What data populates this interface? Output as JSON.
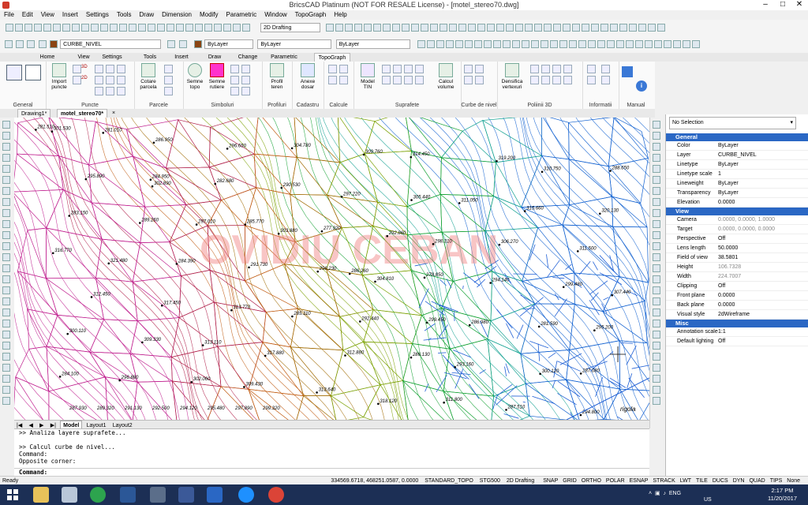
{
  "window": {
    "title": "BricsCAD Platinum (NOT FOR RESALE License) - [motel_stereo70.dwg]",
    "minimize": "–",
    "maximize": "□",
    "close": "✕"
  },
  "menu": [
    "File",
    "Edit",
    "View",
    "Insert",
    "Settings",
    "Tools",
    "Draw",
    "Dimension",
    "Modify",
    "Parametric",
    "Window",
    "TopoGraph",
    "Help"
  ],
  "toolbar": {
    "workspace": "2D Drafting",
    "layer": "CURBE_NIVEL",
    "color": "ByLayer",
    "linetype": "ByLayer",
    "lineweight": "ByLayer"
  },
  "ribbon_tabs": [
    "Home",
    "View",
    "Settings",
    "Tools",
    "Insert",
    "Draw",
    "Change",
    "Parametric",
    "TopoGraph"
  ],
  "ribbon_active_tab": "TopoGraph",
  "ribbon": {
    "groups": [
      "General",
      "Puncte",
      "Parcele",
      "Simboluri",
      "Profiluri",
      "Cadastru",
      "Calcule",
      "Suprafete",
      "Curbe de nivel",
      "Poliinii 3D",
      "Informatii",
      "Manual"
    ],
    "buttons": {
      "import": "Import puncte",
      "cotare": "Cotare parcela",
      "semne_topo": "Semne topo",
      "semne_rutiere": "Semne rutiere",
      "profil": "Profil teren",
      "anexe": "Anexe dosar",
      "model": "Model TIN",
      "calcul": "Calcul volume",
      "densifica": "Densifica vertexuri"
    },
    "mini": {
      "p3d": "3D",
      "p2d": "2D"
    }
  },
  "doc_tabs": [
    "Drawing1*",
    "motel_stereo70*"
  ],
  "doc_active": "motel_stereo70*",
  "layout_tabs": [
    "Model",
    "Layout1",
    "Layout2"
  ],
  "properties": {
    "selection": "No Selection",
    "sections": [
      {
        "name": "General",
        "rows": [
          [
            "Color",
            "ByLayer"
          ],
          [
            "Layer",
            "CURBE_NIVEL"
          ],
          [
            "Linetype",
            "ByLayer"
          ],
          [
            "Linetype scale",
            "1"
          ],
          [
            "Lineweight",
            "ByLayer"
          ],
          [
            "Transparency",
            "ByLayer"
          ],
          [
            "Elevation",
            "0.0000"
          ]
        ]
      },
      {
        "name": "View",
        "rows": [
          [
            "Camera",
            "0.0000, 0.0000, 1.0000"
          ],
          [
            "Target",
            "0.0000, 0.0000, 0.0000"
          ],
          [
            "Perspective",
            "Off"
          ],
          [
            "Lens length",
            "50.0000"
          ],
          [
            "Field of view",
            "38.5801"
          ],
          [
            "Height",
            "106.7328"
          ],
          [
            "Width",
            "224.7007"
          ],
          [
            "Clipping",
            "Off"
          ],
          [
            "Front plane",
            "0.0000"
          ],
          [
            "Back plane",
            "0.0000"
          ],
          [
            "Visual style",
            "2dWireframe"
          ]
        ]
      },
      {
        "name": "Misc",
        "rows": [
          [
            "Annotation scale",
            "1:1"
          ],
          [
            "Default lighting",
            "Off"
          ]
        ]
      }
    ]
  },
  "command": {
    "lines": [
      ">> Analiza layere suprafete...",
      "",
      ">> Calcul curbe de nivel...",
      "Command:",
      "Opposite corner:"
    ],
    "prompt": "Command:"
  },
  "status": {
    "ready": "Ready",
    "coords": "334569.6718, 468251.0587, 0.0000",
    "style": "STANDARD_TOPO",
    "scale": "STG500",
    "workspace": "2D Drafting",
    "toggles": [
      "SNAP",
      "GRID",
      "ORTHO",
      "POLAR",
      "ESNAP",
      "STRACK",
      "LWT",
      "TILE",
      "DUCS",
      "DYN",
      "QUAD",
      "TIPS",
      "None"
    ]
  },
  "drawing": {
    "watermark": "OVIDIU CEBAN",
    "labels": [
      "281.510",
      "284.950",
      "285.770",
      "286.260",
      "286.980",
      "287.080",
      "281.010",
      "282.680",
      "277.920",
      "278.850",
      "281.590",
      "284.100",
      "286.950",
      "290.530",
      "292.860",
      "294.140",
      "295.200",
      "296.880",
      "296.650",
      "297.220",
      "298.310",
      "299.480",
      "300.110",
      "302.060",
      "304.780",
      "305.440",
      "306.270",
      "307.440",
      "309.330",
      "309.430",
      "309.760",
      "311.050",
      "311.500",
      "312.450",
      "313.110",
      "313.640",
      "314.450",
      "315.660",
      "316.770",
      "317.450",
      "317.880",
      "318.120",
      "319.200",
      "320.130",
      "321.480",
      "313.770",
      "312.880",
      "311.800",
      "310.750",
      "283.150",
      "284.390",
      "285.110",
      "286.130",
      "287.510",
      "288.650",
      "289.260",
      "291.730",
      "292.440",
      "293.160",
      "294.800",
      "295.890",
      "297.010",
      "298.230",
      "299.450",
      "300.120",
      "301.530",
      "302.890",
      "303.880",
      "304.810"
    ],
    "road": "rigola",
    "bottom_labels": [
      "287.930",
      "289.320",
      "291.130",
      "292.500",
      "294.120",
      "295.480",
      "297.890",
      "299.320"
    ]
  },
  "taskbar": {
    "lang": "ENG",
    "region": "US",
    "time": "2:17 PM",
    "date": "11/20/2017"
  }
}
